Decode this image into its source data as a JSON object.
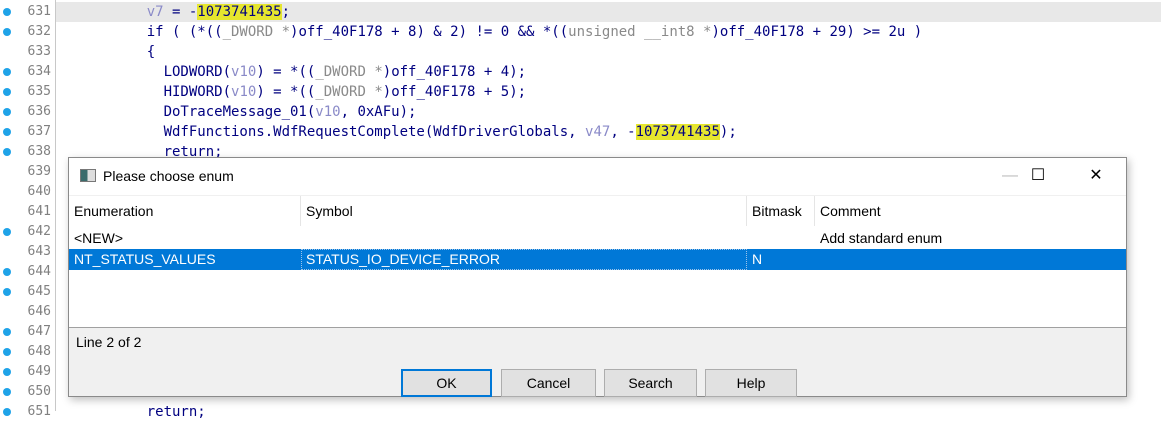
{
  "editor": {
    "lines": [
      {
        "no": "631",
        "dot": true,
        "current": true,
        "parts": [
          [
            "    ",
            ""
          ],
          [
            "v7",
            "v"
          ],
          [
            " = -",
            ""
          ],
          [
            "1073741435",
            "hl"
          ],
          [
            ";",
            ""
          ]
        ]
      },
      {
        "no": "632",
        "dot": true,
        "parts": [
          [
            "    if ( (*((",
            ""
          ],
          [
            "_DWORD *",
            "t"
          ],
          [
            ")off_40F178 + 8) & 2) != 0 && *((",
            ""
          ],
          [
            "unsigned __int8 *",
            "t"
          ],
          [
            ")off_40F178 + 29) >= 2u )",
            ""
          ]
        ]
      },
      {
        "no": "633",
        "dot": false,
        "parts": [
          [
            "    {",
            ""
          ]
        ]
      },
      {
        "no": "634",
        "dot": true,
        "parts": [
          [
            "      LODWORD(",
            ""
          ],
          [
            "v10",
            "v"
          ],
          [
            ") = *((",
            ""
          ],
          [
            "_DWORD *",
            "t"
          ],
          [
            ")off_40F178 + 4);",
            ""
          ]
        ]
      },
      {
        "no": "635",
        "dot": true,
        "parts": [
          [
            "      HIDWORD(",
            ""
          ],
          [
            "v10",
            "v"
          ],
          [
            ") = *((",
            ""
          ],
          [
            "_DWORD *",
            "t"
          ],
          [
            ")off_40F178 + 5);",
            ""
          ]
        ]
      },
      {
        "no": "636",
        "dot": true,
        "parts": [
          [
            "      DoTraceMessage_01(",
            ""
          ],
          [
            "v10",
            "v"
          ],
          [
            ", 0xAFu);",
            ""
          ]
        ]
      },
      {
        "no": "637",
        "dot": true,
        "parts": [
          [
            "      WdfFunctions.WdfRequestComplete(WdfDriverGlobals, ",
            ""
          ],
          [
            "v47",
            "v"
          ],
          [
            ", -",
            ""
          ],
          [
            "1073741435",
            "hl"
          ],
          [
            ");",
            ""
          ]
        ]
      },
      {
        "no": "638",
        "dot": true,
        "parts": [
          [
            "      return;",
            ""
          ]
        ]
      },
      {
        "no": "639",
        "dot": false,
        "parts": []
      },
      {
        "no": "640",
        "dot": false,
        "parts": []
      },
      {
        "no": "641",
        "dot": false,
        "parts": []
      },
      {
        "no": "642",
        "dot": true,
        "parts": []
      },
      {
        "no": "643",
        "dot": false,
        "parts": []
      },
      {
        "no": "644",
        "dot": true,
        "parts": []
      },
      {
        "no": "645",
        "dot": true,
        "parts": []
      },
      {
        "no": "646",
        "dot": false,
        "parts": []
      },
      {
        "no": "647",
        "dot": true,
        "parts": []
      },
      {
        "no": "648",
        "dot": true,
        "parts": []
      },
      {
        "no": "649",
        "dot": true,
        "parts": []
      },
      {
        "no": "650",
        "dot": true,
        "parts": []
      },
      {
        "no": "651",
        "dot": true,
        "parts": [
          [
            "    return;",
            ""
          ]
        ]
      }
    ]
  },
  "dialog": {
    "title": "Please choose enum",
    "columns": [
      "Enumeration",
      "Symbol",
      "Bitmask",
      "Comment"
    ],
    "rows": [
      {
        "enumeration": "<NEW>",
        "symbol": "",
        "bitmask": "",
        "comment": "Add standard enum",
        "selected": false
      },
      {
        "enumeration": "NT_STATUS_VALUES",
        "symbol": "STATUS_IO_DEVICE_ERROR",
        "bitmask": "N",
        "comment": "",
        "selected": true
      }
    ],
    "status": "Line 2 of 2",
    "buttons": {
      "ok": "OK",
      "cancel": "Cancel",
      "search": "Search",
      "help": "Help"
    },
    "window_controls": {
      "minimize": "—",
      "maximize": "☐",
      "close": "✕"
    }
  },
  "colors": {
    "selection": "#0078d7",
    "highlight": "#e6e62e",
    "breakpoint_dot": "#1fa3e8",
    "keyword": "#000080"
  }
}
